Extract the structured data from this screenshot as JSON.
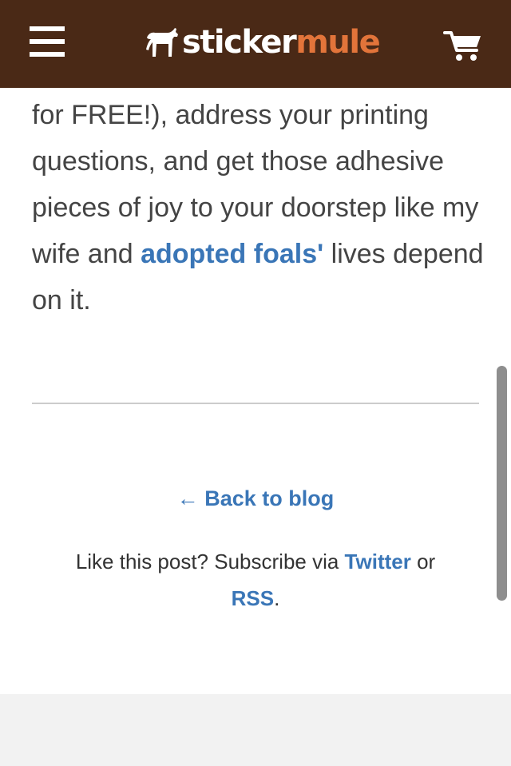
{
  "header": {
    "logo": {
      "word1": "sticker",
      "word2": "mule"
    },
    "menu_icon": "hamburger-menu-icon",
    "cart_icon": "shopping-cart-icon",
    "colors": {
      "background": "#4a2916",
      "logo_accent": "#e2743a"
    }
  },
  "article": {
    "text_1": "for FREE!), address your printing questions, and get those adhesive pieces of joy to your doorstep like my wife and ",
    "link_text": "adopted foals'",
    "text_2": " lives depend on it."
  },
  "footer_nav": {
    "back_arrow": "←",
    "back_label": "Back to blog",
    "subscribe_prefix": "Like this post? Subscribe via ",
    "twitter_label": "Twitter",
    "or_label": " or ",
    "rss_label": "RSS",
    "period": "."
  },
  "colors": {
    "link": "#3a76b7",
    "text": "#444444",
    "footer_band": "#f2f2f2"
  }
}
